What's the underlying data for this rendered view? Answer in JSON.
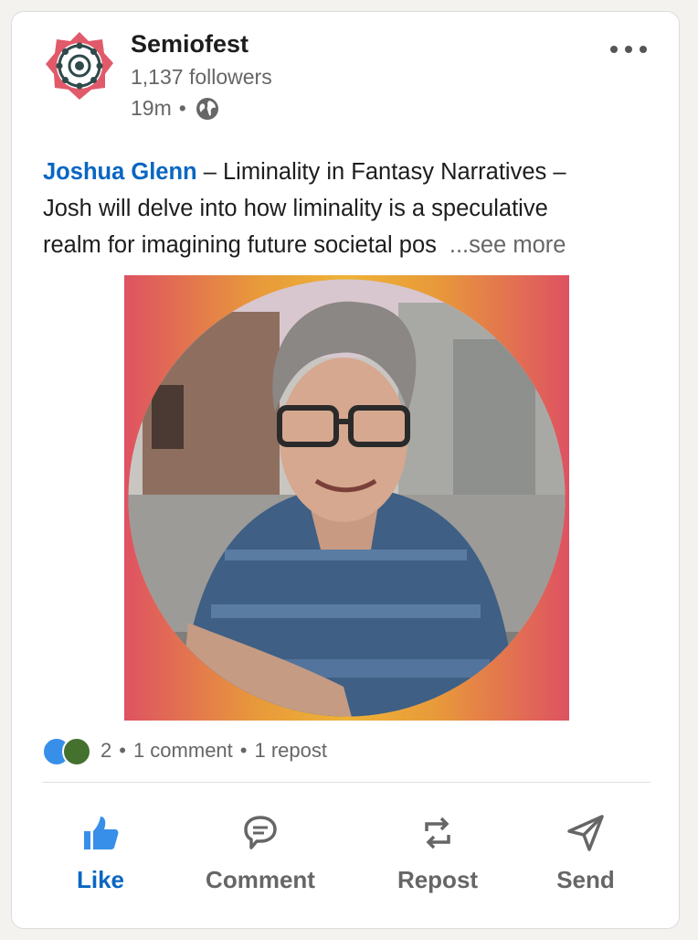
{
  "post": {
    "author": {
      "name": "Semiofest",
      "followers": "1,137 followers",
      "time": "19m",
      "separator": "•",
      "visibility_icon": "globe-icon",
      "logo_icon": "semiofest-logo-icon"
    },
    "menu_icon": "more-options-icon",
    "body": {
      "mention": "Joshua Glenn",
      "line1_rest": " – Liminality in Fantasy Narratives –",
      "line2": "Josh will delve into how liminality is a speculative",
      "line3": "realm for imagining future societal pos",
      "see_more": "...see more"
    },
    "image": {
      "description_icon": "speaker-photo"
    },
    "social": {
      "reaction_icons": [
        "like-reaction-icon",
        "celebrate-reaction-icon"
      ],
      "reaction_count": "2",
      "dot": "•",
      "comments": "1 comment",
      "reposts": "1 repost"
    },
    "actions": {
      "like": "Like",
      "comment": "Comment",
      "repost": "Repost",
      "send": "Send"
    }
  },
  "colors": {
    "brand_blue": "#0a66c2",
    "logo_red": "#e05a6a",
    "text_secondary": "#666666"
  }
}
